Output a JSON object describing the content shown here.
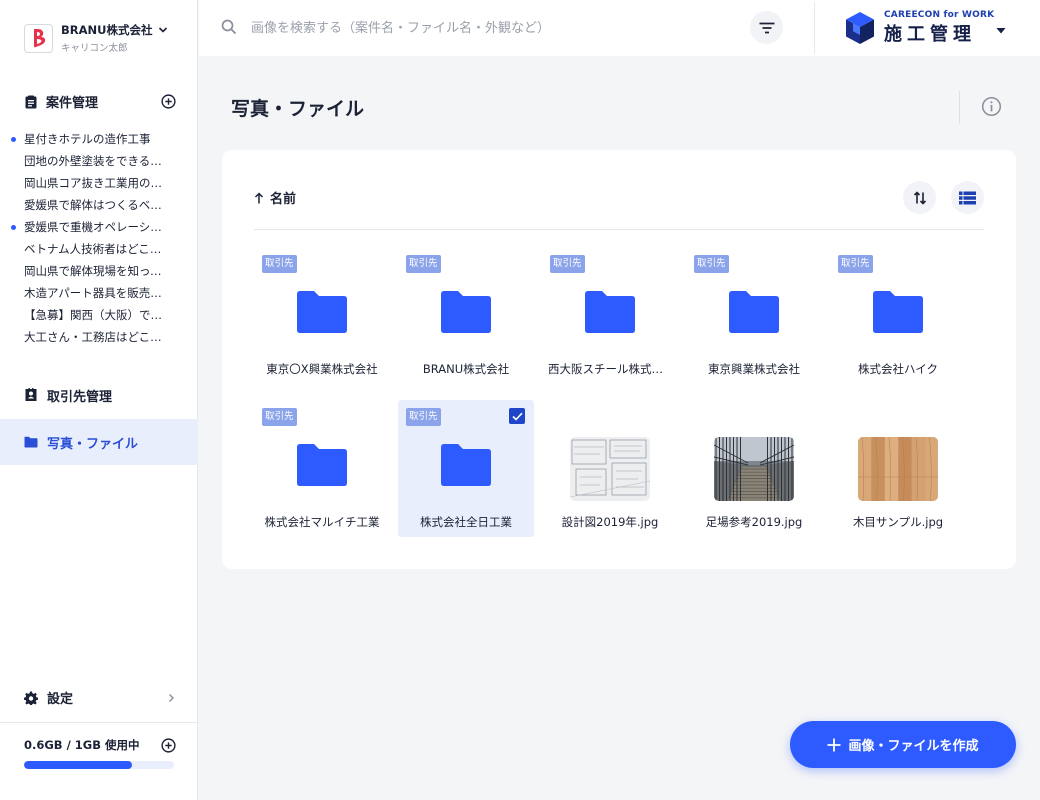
{
  "company": {
    "name": "BRANU株式会社",
    "user": "キャリコン太郎"
  },
  "sidebar": {
    "projects_section": {
      "label": "案件管理",
      "icon": "clipboard-icon"
    },
    "projects": [
      {
        "label": "星付きホテルの造作工事",
        "dot": true
      },
      {
        "label": "団地の外壁塗装をできる職人",
        "dot": false
      },
      {
        "label": "岡山県コア抜き工業用のスタッフ",
        "dot": false
      },
      {
        "label": "愛媛県で解体はつくるベテラン",
        "dot": false
      },
      {
        "label": "愛媛県で重機オペレーション",
        "dot": true
      },
      {
        "label": "ベトナム人技術者はどこですか",
        "dot": false
      },
      {
        "label": "岡山県で解体現場を知っている方",
        "dot": false
      },
      {
        "label": "木造アパート器具を販売する人",
        "dot": false
      },
      {
        "label": "【急募】関西（大阪）での工事",
        "dot": false
      },
      {
        "label": "大工さん・工務店はどこですか",
        "dot": false
      }
    ],
    "clients": {
      "label": "取引先管理",
      "icon": "contacts-book-icon"
    },
    "files": {
      "label": "写真・ファイル",
      "icon": "folder-icon",
      "active": true
    },
    "settings": {
      "label": "設定",
      "icon": "gear-icon"
    },
    "storage": {
      "label": "0.6GB / 1GB 使用中",
      "used_fraction": 0.72
    }
  },
  "search": {
    "placeholder": "画像を検索する（案件名・ファイル名・外観など）"
  },
  "brand": {
    "top": "CAREECON for WORK",
    "main": "施工管理"
  },
  "page": {
    "title": "写真・ファイル"
  },
  "list": {
    "sort_label": "名前",
    "badge_label": "取引先",
    "items": [
      {
        "type": "folder",
        "name": "東京〇X興業株式会社",
        "badge": true,
        "selected": false
      },
      {
        "type": "folder",
        "name": "BRANU株式会社",
        "badge": true,
        "selected": false
      },
      {
        "type": "folder",
        "name": "西大阪スチール株式会社",
        "badge": true,
        "selected": false
      },
      {
        "type": "folder",
        "name": "東京興業株式会社",
        "badge": true,
        "selected": false
      },
      {
        "type": "folder",
        "name": "株式会社ハイク",
        "badge": true,
        "selected": false
      },
      {
        "type": "folder",
        "name": "株式会社マルイチ工業",
        "badge": true,
        "selected": false
      },
      {
        "type": "folder",
        "name": "株式会社全日工業",
        "badge": true,
        "selected": true
      },
      {
        "type": "image",
        "name": "設計図2019年.jpg",
        "thumb": "blueprint"
      },
      {
        "type": "image",
        "name": "足場参考2019.jpg",
        "thumb": "scaffold"
      },
      {
        "type": "image",
        "name": "木目サンプル.jpg",
        "thumb": "wood"
      }
    ]
  },
  "fab": {
    "label": "画像・ファイルを作成"
  },
  "colors": {
    "accent": "#2e5bff",
    "badge": "#8aa3ea",
    "selected_bg": "#e9eefc",
    "text": "#1c2236"
  }
}
